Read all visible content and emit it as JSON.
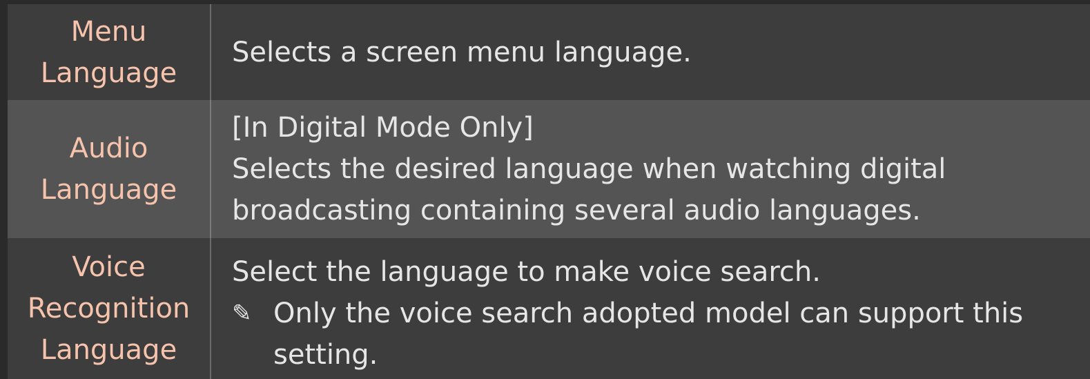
{
  "rows": [
    {
      "label": [
        "Menu",
        "Language"
      ],
      "lines": [
        "Selects a screen menu language."
      ]
    },
    {
      "label": [
        "Audio",
        "Language"
      ],
      "lines": [
        "[In Digital Mode Only]",
        "Selects the desired language when watching digital",
        "broadcasting containing several audio languages."
      ]
    },
    {
      "label": [
        "Voice",
        "Recognition",
        "Language"
      ],
      "lines": [
        "Select the language to make voice search."
      ],
      "note": {
        "icon": "pencil-note-icon",
        "lines": [
          "Only the voice search adopted model can support this",
          "setting."
        ]
      }
    }
  ],
  "colors": {
    "background": "#2a2a2a",
    "row_dark": "#3d3d3d",
    "row_light": "#545454",
    "label_text": "#f6c3ad",
    "body_text": "#e6e6e6"
  }
}
